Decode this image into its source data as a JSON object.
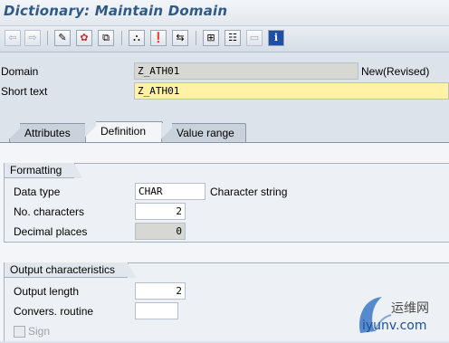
{
  "window": {
    "title": "Dictionary: Maintain Domain"
  },
  "toolbar": {
    "buttons": [
      {
        "name": "back-icon",
        "glyph": "⇦"
      },
      {
        "name": "forward-icon",
        "glyph": "⇨"
      },
      {
        "name": "display-change-icon",
        "glyph": "✎"
      },
      {
        "name": "check-icon",
        "glyph": "✿"
      },
      {
        "name": "activate-icon",
        "glyph": "⧉"
      },
      {
        "name": "where-used-icon",
        "glyph": "⛬"
      },
      {
        "name": "object-list-icon",
        "glyph": "❗"
      },
      {
        "name": "navigate-icon",
        "glyph": "⇆"
      },
      {
        "name": "hierarchy-icon",
        "glyph": "⊞"
      },
      {
        "name": "print-icon",
        "glyph": "☷"
      },
      {
        "name": "layout-icon",
        "glyph": "▭"
      },
      {
        "name": "info-icon",
        "glyph": "i"
      }
    ]
  },
  "header": {
    "domain_label": "Domain",
    "domain_value": "Z_ATH01",
    "status": "New(Revised)",
    "short_text_label": "Short text",
    "short_text_value": "Z_ATH01"
  },
  "tabs": [
    {
      "label": "Attributes",
      "active": false
    },
    {
      "label": "Definition",
      "active": true
    },
    {
      "label": "Value range",
      "active": false
    }
  ],
  "formatting": {
    "title": "Formatting",
    "data_type_label": "Data type",
    "data_type_value": "CHAR",
    "data_type_desc": "Character string",
    "no_chars_label": "No. characters",
    "no_chars_value": "2",
    "decimal_label": "Decimal places",
    "decimal_value": "0"
  },
  "output": {
    "title": "Output characteristics",
    "length_label": "Output length",
    "length_value": "2",
    "conv_label": "Convers. routine",
    "conv_value": "",
    "sign_label": "Sign"
  },
  "watermark": {
    "text_cn": "运维网",
    "text_url": "iyunv.com"
  },
  "colors": {
    "title": "#2f5a86",
    "short_text_bg": "#fff1a6",
    "accent_blue": "#3a78c4"
  }
}
